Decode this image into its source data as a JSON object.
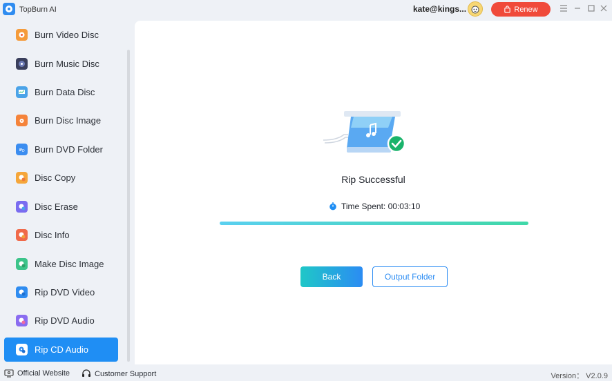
{
  "app": {
    "title": "TopBurn AI",
    "user_email": "kate@kings...",
    "renew_label": "Renew"
  },
  "window_controls": {
    "menu_icon": "hamburger-icon",
    "minimize_icon": "minimize-icon",
    "maximize_icon": "maximize-icon",
    "close_icon": "close-icon"
  },
  "sidebar": {
    "items": [
      {
        "label": "Burn Video Disc",
        "icon": "video-disc-icon",
        "color": "#f59b3a"
      },
      {
        "label": "Burn Music Disc",
        "icon": "music-disc-icon",
        "color": "#3a3f5c"
      },
      {
        "label": "Burn Data Disc",
        "icon": "data-disc-icon",
        "color": "#4aa3e8"
      },
      {
        "label": "Burn Disc Image",
        "icon": "disc-image-icon",
        "color": "#f5833a"
      },
      {
        "label": "Burn DVD Folder",
        "icon": "dvd-folder-icon",
        "color": "#3b8df0"
      },
      {
        "label": "Disc Copy",
        "icon": "disc-copy-icon",
        "color": "#f5a63a"
      },
      {
        "label": "Disc Erase",
        "icon": "disc-erase-icon",
        "color": "#7a6cf0"
      },
      {
        "label": "Disc Info",
        "icon": "disc-info-icon",
        "color": "#f06a4a"
      },
      {
        "label": "Make Disc Image",
        "icon": "make-disc-image-icon",
        "color": "#3cc48a"
      },
      {
        "label": "Rip DVD Video",
        "icon": "rip-dvd-video-icon",
        "color": "#2f8cf0"
      },
      {
        "label": "Rip DVD Audio",
        "icon": "rip-dvd-audio-icon",
        "color": "#8a6cf0"
      },
      {
        "label": "Rip CD Audio",
        "icon": "rip-cd-audio-icon",
        "color": "#2f8cf0",
        "active": true
      }
    ]
  },
  "main": {
    "status_title": "Rip Successful",
    "time_spent": "Time Spent: 00:03:10",
    "progress": 1.0,
    "back_label": "Back",
    "output_folder_label": "Output Folder"
  },
  "footer": {
    "website_label": "Official Website",
    "support_label": "Customer Support",
    "version": "Version： V2.0.9"
  },
  "colors": {
    "accent": "#2b8cf3",
    "renew": "#f04a3a",
    "active_sidebar": "#1f8ef4",
    "success": "#19b36b"
  }
}
